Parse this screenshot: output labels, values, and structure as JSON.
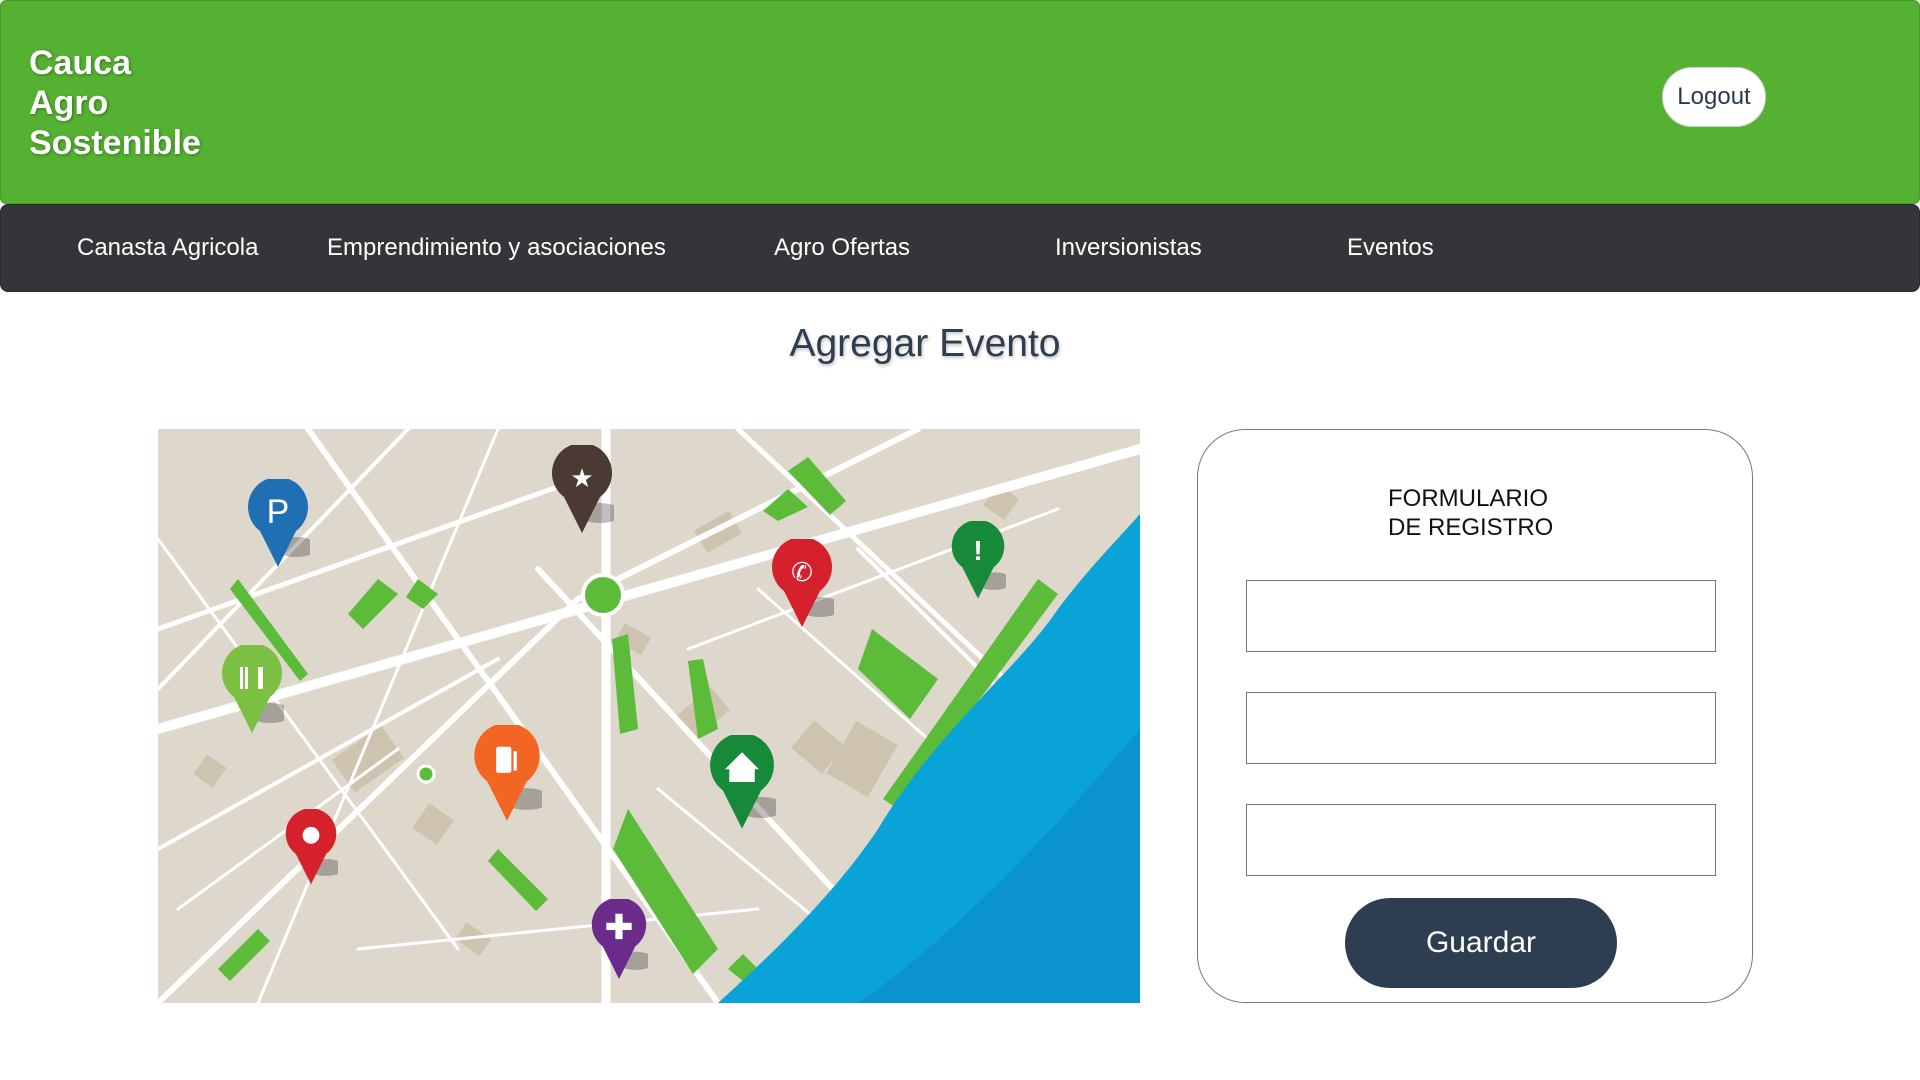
{
  "brand": {
    "line1": "Cauca",
    "line2": "Agro",
    "line3": "Sostenible"
  },
  "header": {
    "logout_label": "Logout"
  },
  "nav": {
    "items": [
      {
        "label": "Canasta Agricola"
      },
      {
        "label": "Emprendimiento y asociaciones"
      },
      {
        "label": "Agro Ofertas"
      },
      {
        "label": "Inversionistas"
      },
      {
        "label": "Eventos"
      }
    ]
  },
  "page": {
    "title": "Agregar Evento"
  },
  "map": {
    "colors": {
      "land": "#ddd7cc",
      "road": "#ffffff",
      "park": "#5cbc3a",
      "water": "#0aa3d8",
      "block": "#cbbfa8"
    },
    "pins": [
      {
        "icon": "parking-icon",
        "glyph": "P",
        "color": "#1f6fb5"
      },
      {
        "icon": "star-icon",
        "glyph": "★",
        "color": "#4a3a33"
      },
      {
        "icon": "phone-icon",
        "glyph": "✆",
        "color": "#d4212b"
      },
      {
        "icon": "alert-icon",
        "glyph": "!",
        "color": "#178a3a"
      },
      {
        "icon": "restaurant-icon",
        "glyph": "🍴",
        "color": "#7cc043"
      },
      {
        "icon": "fuel-icon",
        "glyph": "⛽",
        "color": "#f26522"
      },
      {
        "icon": "home-icon",
        "glyph": "⌂",
        "color": "#178a3a"
      },
      {
        "icon": "location-icon",
        "glyph": "●",
        "color": "#d4212b"
      },
      {
        "icon": "hospital-icon",
        "glyph": "+",
        "color": "#6b2b8a"
      }
    ]
  },
  "form": {
    "title_line1": "FORMULARIO",
    "title_line2": "DE REGISTRO",
    "field1_value": "",
    "field2_value": "",
    "field3_value": "",
    "save_label": "Guardar"
  }
}
